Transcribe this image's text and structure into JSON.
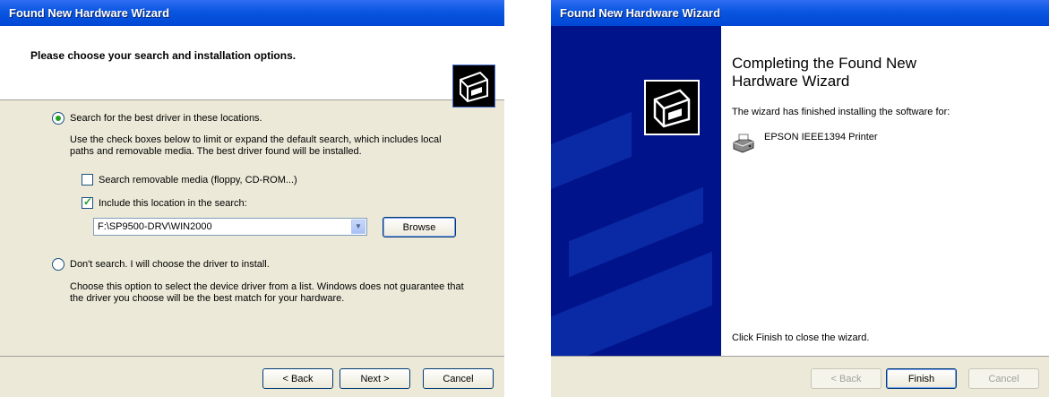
{
  "colors": {
    "titlebar": "#0a56e0",
    "dialog_bg": "#ece9d8",
    "watermark": "#00138a",
    "radio_check": "#21a121"
  },
  "left": {
    "title": "Found New Hardware Wizard",
    "heading": "Please choose your search and installation options.",
    "header_icon": "hardware-wizard-icon",
    "option_search": "Search for the best driver in these locations.",
    "search_desc_line1": "Use the check boxes below to limit or expand the default search, which includes local",
    "search_desc_line2": "paths and removable media. The best driver found will be installed.",
    "check_removable": "Search removable media (floppy, CD-ROM...)",
    "check_include": "Include this location in the search:",
    "location_value": "F:\\SP9500-DRV\\WIN2000",
    "browse": "Browse",
    "option_dont_search": "Don't search. I will choose the driver to install.",
    "dont_desc_line1": "Choose this option to select the device driver from a list.  Windows does not guarantee that",
    "dont_desc_line2": "the driver you choose will be the best match for your hardware.",
    "back": "< Back",
    "next": "Next >",
    "cancel": "Cancel"
  },
  "right": {
    "title": "Found New Hardware Wizard",
    "heading_line1": "Completing the Found New",
    "heading_line2": "Hardware Wizard",
    "message": "The wizard has finished installing the software for:",
    "device": "EPSON IEEE1394 Printer",
    "device_icon": "printer-icon",
    "finish_hint": "Click Finish to close the wizard.",
    "back": "< Back",
    "finish": "Finish",
    "cancel": "Cancel"
  }
}
